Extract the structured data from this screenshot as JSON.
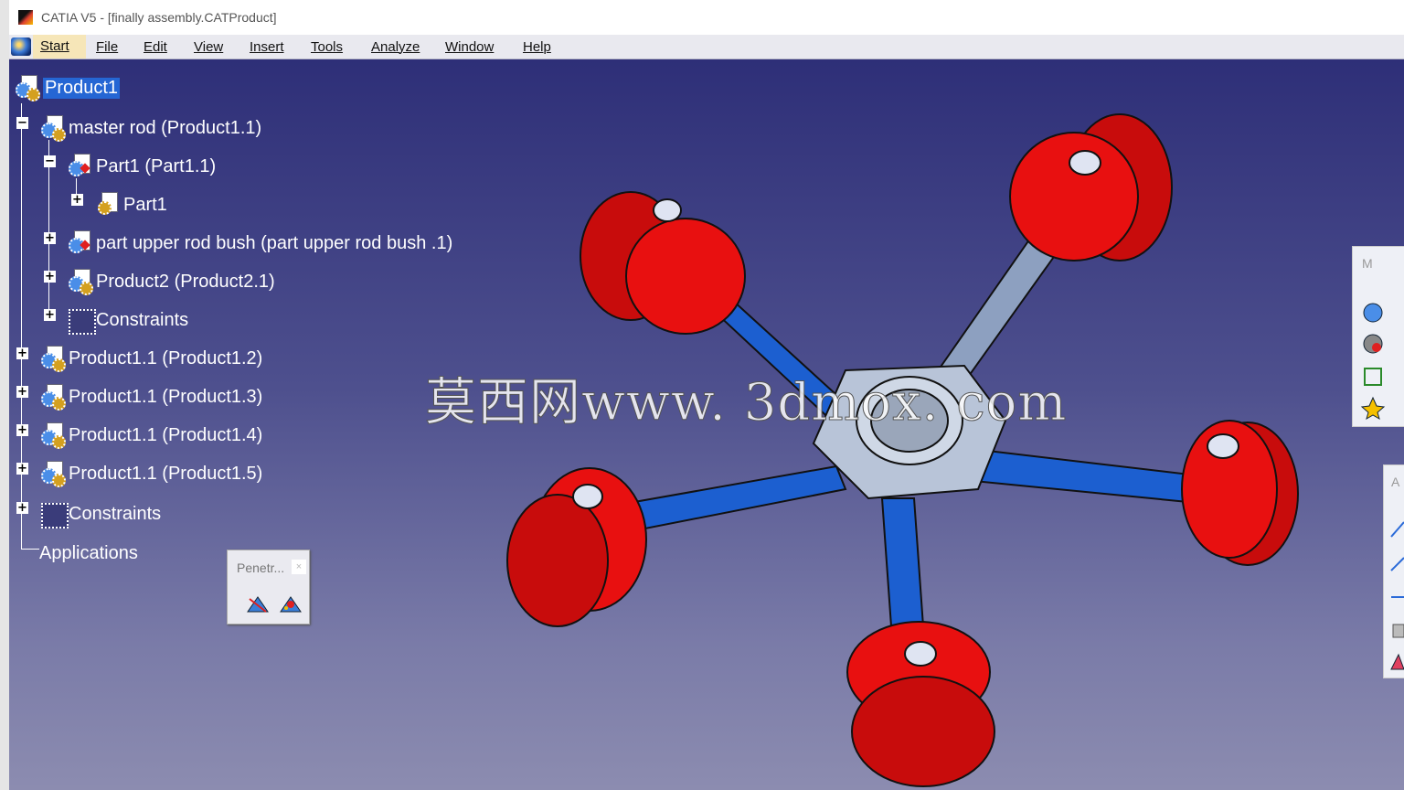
{
  "window": {
    "title": "CATIA V5 - [finally assembly.CATProduct]"
  },
  "menu": [
    {
      "label": "Start"
    },
    {
      "label": "File"
    },
    {
      "label": "Edit"
    },
    {
      "label": "View"
    },
    {
      "label": "Insert"
    },
    {
      "label": "Tools"
    },
    {
      "label": "Analyze"
    },
    {
      "label": "Window"
    },
    {
      "label": "Help"
    }
  ],
  "tree": {
    "root": "Product1",
    "items": [
      {
        "label": "master rod  (Product1.1)"
      },
      {
        "label": "Part1 (Part1.1)"
      },
      {
        "label": "Part1"
      },
      {
        "label": "part upper rod bush  (part upper rod bush .1)"
      },
      {
        "label": "Product2 (Product2.1)"
      },
      {
        "label": "Constraints"
      },
      {
        "label": "Product1.1 (Product1.2)"
      },
      {
        "label": "Product1.1 (Product1.3)"
      },
      {
        "label": "Product1.1 (Product1.4)"
      },
      {
        "label": "Product1.1 (Product1.5)"
      },
      {
        "label": "Constraints"
      },
      {
        "label": "Applications"
      }
    ]
  },
  "toolbars": {
    "penetration": {
      "title": "Penetr...",
      "close": "×"
    },
    "right_top": {
      "title": "M"
    },
    "right_mid": {
      "title": "A"
    }
  },
  "watermark": "莫西网www. 3dmox. com",
  "colors": {
    "background_top": "#2e2f78",
    "background_bottom": "#8c8cb0",
    "piston": "#e81010",
    "rod": "#1c5fd0",
    "hub": "#b8c4d8",
    "selection": "#2566d4"
  }
}
